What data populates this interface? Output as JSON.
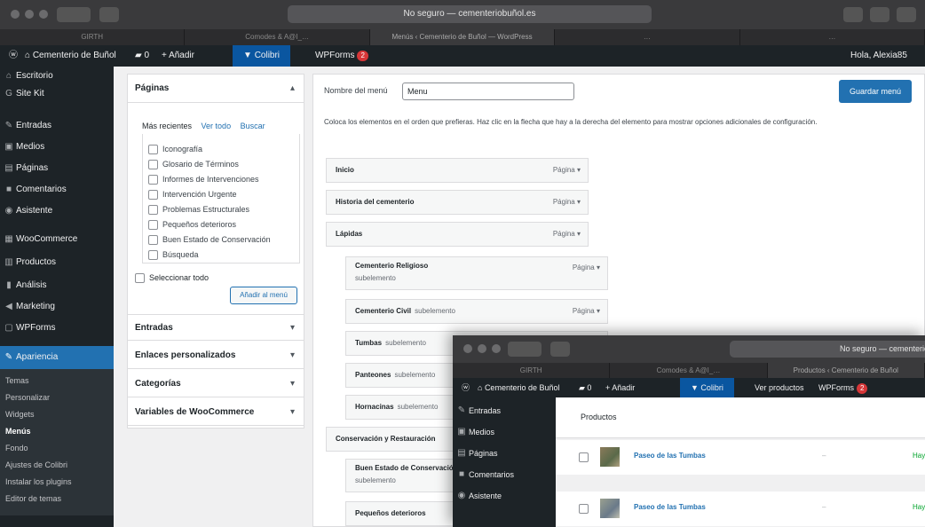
{
  "browser": {
    "url": "No seguro — cementeriobuñol.es",
    "tabs": [
      "GIRTH",
      "Comodes & A@I_…",
      "Menús ‹ Cementerio de Buñol — WordPress",
      "…",
      "…"
    ]
  },
  "adminbar": {
    "site": "Cementerio de Buñol",
    "comments": "0",
    "add": "Añadir",
    "colibri": "Colibri",
    "wpforms": "WPForms",
    "wpforms_badge": "2",
    "greeting": "Hola, Alexia85"
  },
  "sidebar": {
    "items": [
      {
        "icon": "dashboard-icon",
        "glyph": "⌂",
        "label": "Escritorio"
      },
      {
        "icon": "sitekit-icon",
        "glyph": "G",
        "label": "Site Kit"
      },
      {
        "icon": "pin-icon",
        "glyph": "✎",
        "label": "Entradas"
      },
      {
        "icon": "media-icon",
        "glyph": "▣",
        "label": "Medios"
      },
      {
        "icon": "pages-icon",
        "glyph": "▤",
        "label": "Páginas"
      },
      {
        "icon": "comments-icon",
        "glyph": "■",
        "label": "Comentarios"
      },
      {
        "icon": "assistant-icon",
        "glyph": "◉",
        "label": "Asistente"
      },
      {
        "icon": "woocommerce-icon",
        "glyph": "▦",
        "label": "WooCommerce"
      },
      {
        "icon": "products-icon",
        "glyph": "▥",
        "label": "Productos"
      },
      {
        "icon": "analytics-icon",
        "glyph": "▮",
        "label": "Análisis"
      },
      {
        "icon": "marketing-icon",
        "glyph": "◀",
        "label": "Marketing"
      },
      {
        "icon": "wpforms-icon",
        "glyph": "▢",
        "label": "WPForms"
      },
      {
        "icon": "appearance-icon",
        "glyph": "✎",
        "label": "Apariencia"
      }
    ],
    "submenu": [
      "Temas",
      "Personalizar",
      "Widgets",
      "Menús",
      "Fondo",
      "Ajustes de Colibri",
      "Instalar los plugins",
      "Editor de temas"
    ]
  },
  "left_panel": {
    "pages_title": "Páginas",
    "tabs": [
      "Más recientes",
      "Ver todo",
      "Buscar"
    ],
    "items": [
      "Iconografía",
      "Glosario de Términos",
      "Informes de Intervenciones",
      "Intervención Urgente",
      "Problemas Estructurales",
      "Pequeños deterioros",
      "Buen Estado de Conservación",
      "Búsqueda"
    ],
    "select_all": "Seleccionar todo",
    "add_button": "Añadir al menú",
    "sections": [
      "Entradas",
      "Enlaces personalizados",
      "Categorías",
      "Variables de WooCommerce"
    ]
  },
  "main": {
    "menu_name_label": "Nombre del menú",
    "menu_name_value": "Menu",
    "save_button": "Guardar menú",
    "description": "Coloca los elementos en el orden que prefieras. Haz clic en la flecha que hay a la derecha del elemento para mostrar opciones adicionales de configuración.",
    "items": [
      {
        "label": "Inicio",
        "type": "Página",
        "sub": ""
      },
      {
        "label": "Historia del cementerio",
        "type": "Página",
        "sub": ""
      },
      {
        "label": "Lápidas",
        "type": "Página",
        "sub": ""
      },
      {
        "label": "Cementerio Religioso",
        "type": "Página",
        "sub": "subelemento"
      },
      {
        "label": "Cementerio Civil",
        "type": "Página",
        "sub": "subelemento"
      },
      {
        "label": "Tumbas",
        "type": "",
        "sub": "subelemento"
      },
      {
        "label": "Panteones",
        "type": "",
        "sub": "subelemento"
      },
      {
        "label": "Hornacinas",
        "type": "",
        "sub": "subelemento"
      },
      {
        "label": "Conservación y Restauración",
        "type": "",
        "sub": ""
      },
      {
        "label": "Buen Estado de Conservación",
        "type": "",
        "sub": "subelemento"
      },
      {
        "label": "Pequeños deterioros",
        "type": "",
        "sub": ""
      }
    ]
  },
  "overlay": {
    "url": "No seguro — cementeriobuñol.es",
    "tabs": [
      "GIRTH",
      "Comodes & A@I_…",
      "Productos ‹ Cementerio de Buñol"
    ],
    "admin": {
      "site": "Cementerio de Buñol",
      "comments": "0",
      "add": "Añadir",
      "colibri": "Colibri",
      "view": "Ver productos",
      "wpforms": "WPForms",
      "badge": "2"
    },
    "sidebar": [
      {
        "icon": "pin-icon",
        "glyph": "✎",
        "label": "Entradas"
      },
      {
        "icon": "media-icon",
        "glyph": "▣",
        "label": "Medios"
      },
      {
        "icon": "pages-icon",
        "glyph": "▤",
        "label": "Páginas"
      },
      {
        "icon": "comments-icon",
        "glyph": "■",
        "label": "Comentarios"
      },
      {
        "icon": "assistant-icon",
        "glyph": "◉",
        "label": "Asistente"
      }
    ],
    "heading": "Productos",
    "rows": [
      {
        "name": "Paseo de las Tumbas",
        "dash": "–",
        "stock": "Hay existencias"
      },
      {
        "name": "Paseo de las Tumbas",
        "dash": "–",
        "stock": "Hay existencias"
      }
    ]
  },
  "colors": {
    "accent": "#2271b1",
    "adminbar": "#1d2327",
    "badge": "#d63638",
    "stock": "#00a32a"
  }
}
